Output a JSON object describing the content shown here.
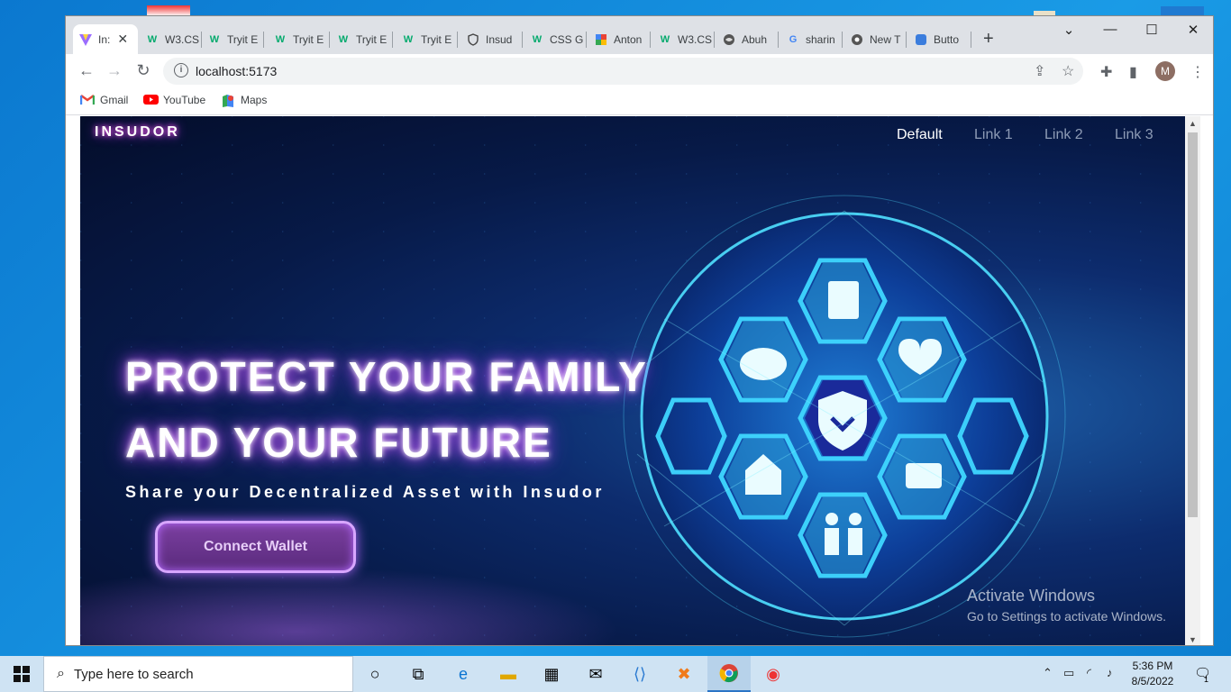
{
  "browser": {
    "tabs": [
      {
        "label": "In:",
        "icon": "vite-icon",
        "active": true
      },
      {
        "label": "W3.CS",
        "icon": "w3schools-icon"
      },
      {
        "label": "Tryit E",
        "icon": "w3schools-icon"
      },
      {
        "label": "Tryit E",
        "icon": "w3schools-icon"
      },
      {
        "label": "Tryit E",
        "icon": "w3schools-icon"
      },
      {
        "label": "Tryit E",
        "icon": "w3schools-icon"
      },
      {
        "label": "Insud",
        "icon": "shield-icon"
      },
      {
        "label": "CSS G",
        "icon": "w3schools-icon"
      },
      {
        "label": "Anton",
        "icon": "fonts-icon"
      },
      {
        "label": "W3.CS",
        "icon": "w3schools-icon"
      },
      {
        "label": "Abuh",
        "icon": "globe-icon"
      },
      {
        "label": "sharin",
        "icon": "google-icon"
      },
      {
        "label": "New T",
        "icon": "chrome-icon"
      },
      {
        "label": "Butto",
        "icon": "page-icon"
      }
    ],
    "new_tab": "+",
    "url": "localhost:5173",
    "profile_initial": "M",
    "bookmarks": [
      {
        "label": "Gmail",
        "icon": "gmail-icon"
      },
      {
        "label": "YouTube",
        "icon": "youtube-icon"
      },
      {
        "label": "Maps",
        "icon": "maps-icon"
      }
    ]
  },
  "site": {
    "brand": "INSUDOR",
    "nav": [
      "Default",
      "Link 1",
      "Link 2",
      "Link 3"
    ],
    "hero": {
      "line1": "PROTECT YOUR FAMILY",
      "line2": "AND YOUR FUTURE",
      "subtitle": "Share your Decentralized Asset with Insudor",
      "cta": "Connect Wallet"
    }
  },
  "watermark": {
    "title": "Activate Windows",
    "subtitle": "Go to Settings to activate Windows."
  },
  "taskbar": {
    "search_placeholder": "Type here to search",
    "time": "5:36 PM",
    "date": "8/5/2022",
    "notification_count": "1"
  },
  "colors": {
    "accent_glow": "#c43fff",
    "hero_bg": "#071a48",
    "globe_cyan": "#4fe0ff"
  }
}
